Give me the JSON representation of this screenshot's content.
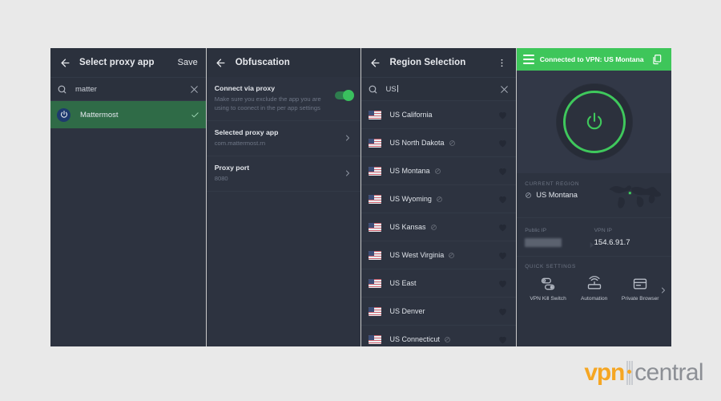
{
  "panel_proxy_app": {
    "header": {
      "back_icon": "arrow-left-icon",
      "title": "Select proxy app",
      "save_label": "Save"
    },
    "search": {
      "icon": "search-icon",
      "value": "matter",
      "placeholder": "Search",
      "clear_icon": "close-icon"
    },
    "results": [
      {
        "name": "Mattermost",
        "icon": "mattermost-icon",
        "selected": true,
        "check_icon": "check-icon"
      }
    ]
  },
  "panel_obfuscation": {
    "header": {
      "back_icon": "arrow-left-icon",
      "title": "Obfuscation"
    },
    "rows": [
      {
        "title": "Connect via proxy",
        "subtitle": "Make sure you exclude the app you are using to coonect in the per app settings",
        "control": "toggle",
        "toggle_on": true
      },
      {
        "title": "Selected proxy app",
        "subtitle": "com.mattermost.rn",
        "control": "chevron",
        "chevron_icon": "chevron-right-icon"
      },
      {
        "title": "Proxy port",
        "subtitle": "8080",
        "control": "chevron",
        "chevron_icon": "chevron-right-icon"
      }
    ]
  },
  "panel_region_selection": {
    "header": {
      "back_icon": "arrow-left-icon",
      "title": "Region Selection",
      "overflow_icon": "more-vertical-icon"
    },
    "search": {
      "icon": "search-icon",
      "value": "US",
      "placeholder": "Search region",
      "clear_icon": "close-icon"
    },
    "regions": [
      {
        "name": "US California",
        "flag": "us-flag-icon",
        "badge": false,
        "favorite_icon": "heart-icon"
      },
      {
        "name": "US North Dakota",
        "flag": "us-flag-icon",
        "badge": true,
        "favorite_icon": "heart-icon"
      },
      {
        "name": "US Montana",
        "flag": "us-flag-icon",
        "badge": true,
        "favorite_icon": "heart-icon"
      },
      {
        "name": "US Wyoming",
        "flag": "us-flag-icon",
        "badge": true,
        "favorite_icon": "heart-icon"
      },
      {
        "name": "US Kansas",
        "flag": "us-flag-icon",
        "badge": true,
        "favorite_icon": "heart-icon"
      },
      {
        "name": "US West Virginia",
        "flag": "us-flag-icon",
        "badge": true,
        "favorite_icon": "heart-icon"
      },
      {
        "name": "US East",
        "flag": "us-flag-icon",
        "badge": false,
        "favorite_icon": "heart-icon"
      },
      {
        "name": "US Denver",
        "flag": "us-flag-icon",
        "badge": false,
        "favorite_icon": "heart-icon"
      },
      {
        "name": "US Connecticut",
        "flag": "us-flag-icon",
        "badge": true,
        "favorite_icon": "heart-icon"
      }
    ]
  },
  "panel_vpn_home": {
    "status_bar": {
      "menu_icon": "hamburger-icon",
      "text": "Connected to VPN: US Montana",
      "right_icon": "copy-icon",
      "color": "#3ec65a"
    },
    "power_button": {
      "icon": "power-icon",
      "ring_color": "#3fc85c",
      "state": "connected"
    },
    "current_region": {
      "caption": "CURRENT REGION",
      "value": "US Montana",
      "badge_icon": "obfuscation-icon",
      "map_icon": "world-map-icon"
    },
    "ip_info": {
      "public_ip_label": "Public IP",
      "public_ip_value": "",
      "public_ip_redacted": true,
      "arrow_icon": "arrow-right-icon",
      "vpn_ip_label": "VPN IP",
      "vpn_ip_value": "154.6.91.7"
    },
    "quick_settings": {
      "caption": "QUICK SETTINGS",
      "next_icon": "chevron-right-icon",
      "items": [
        {
          "label": "VPN Kill Switch",
          "icon": "kill-switch-icon"
        },
        {
          "label": "Automation",
          "icon": "router-icon"
        },
        {
          "label": "Private Browser",
          "icon": "browser-icon"
        }
      ]
    }
  },
  "watermark": {
    "brand_first": "vpn",
    "brand_second": "central",
    "accent_color": "#f5a623",
    "secondary_color": "#8c8f95"
  }
}
